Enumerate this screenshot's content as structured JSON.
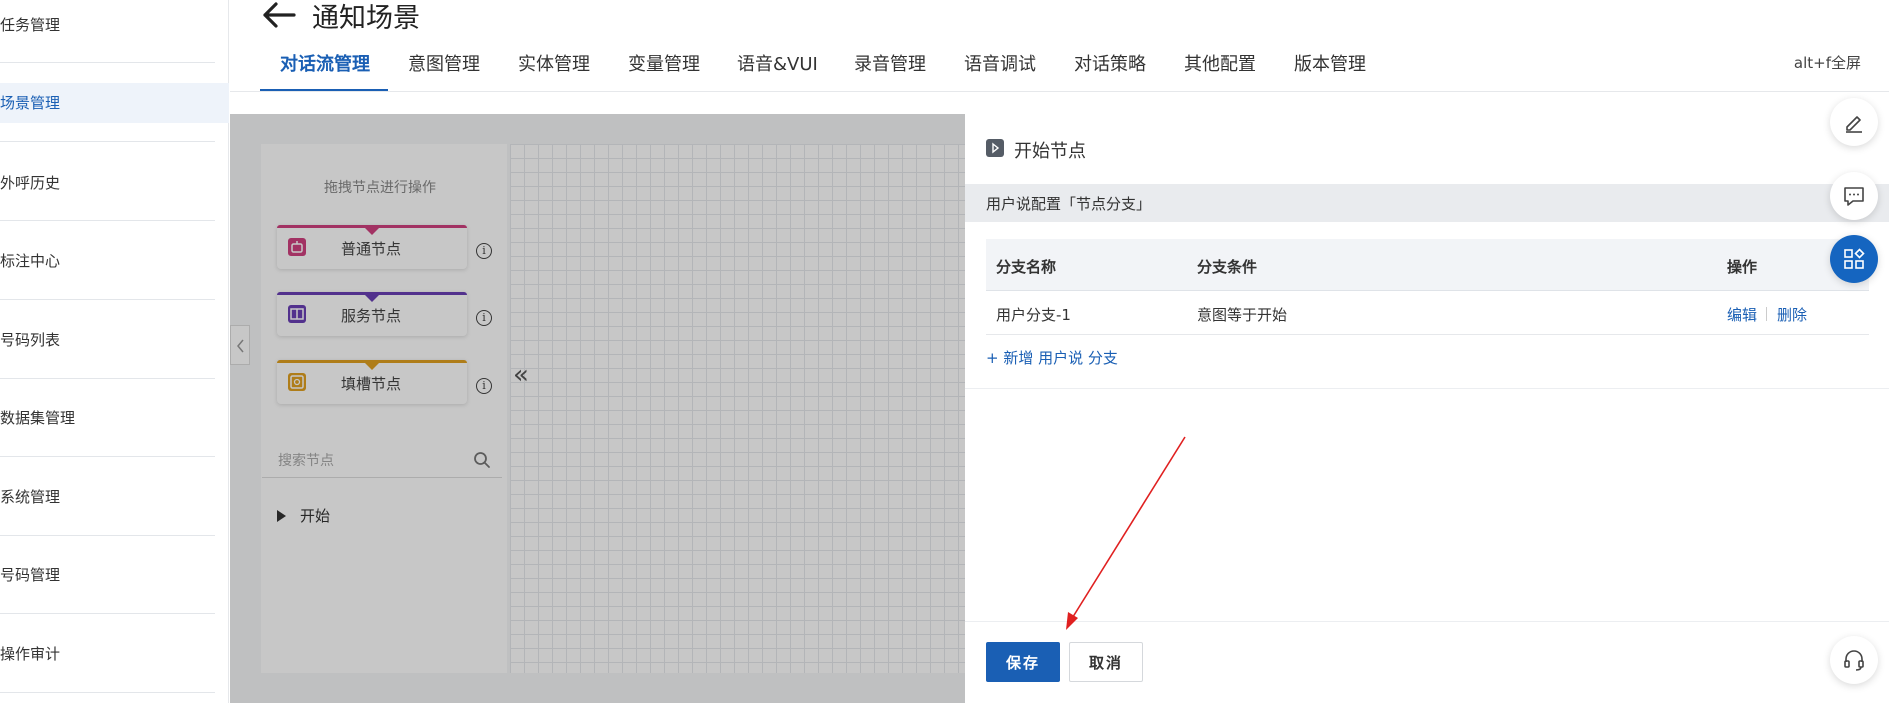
{
  "sidebar": {
    "items": [
      {
        "label": "任务管理"
      },
      {
        "label": "场景管理"
      },
      {
        "label": "外呼历史"
      },
      {
        "label": "标注中心"
      },
      {
        "label": "号码列表"
      },
      {
        "label": "数据集管理"
      },
      {
        "label": "系统管理"
      },
      {
        "label": "号码管理"
      },
      {
        "label": "操作审计"
      }
    ],
    "active_index": 1
  },
  "header": {
    "title": "通知场景",
    "tabs": [
      {
        "label": "对话流管理"
      },
      {
        "label": "意图管理"
      },
      {
        "label": "实体管理"
      },
      {
        "label": "变量管理"
      },
      {
        "label": "语音&VUI"
      },
      {
        "label": "录音管理"
      },
      {
        "label": "语音调试"
      },
      {
        "label": "对话策略"
      },
      {
        "label": "其他配置"
      },
      {
        "label": "版本管理"
      }
    ],
    "active_tab_index": 0,
    "fullscreen_hint": "alt+f全屏"
  },
  "canvas": {
    "drag_hint": "拖拽节点进行操作",
    "nodes": [
      {
        "label": "普通节点",
        "color": "#d0407f"
      },
      {
        "label": "服务节点",
        "color": "#6a3fb5"
      },
      {
        "label": "填槽节点",
        "color": "#e0a020"
      }
    ],
    "search": {
      "placeholder": "搜索节点",
      "value": ""
    },
    "tree_root": "开始",
    "collapse_glyph": "«"
  },
  "drawer": {
    "title": "开始节点",
    "section_title": "用户说配置「节点分支」",
    "table": {
      "headers": [
        "分支名称",
        "分支条件",
        "操作"
      ],
      "rows": [
        {
          "name": "用户分支-1",
          "condition": "意图等于开始",
          "actions": [
            "编辑",
            "删除"
          ]
        }
      ]
    },
    "add_branch_label": "+ 新增 用户说 分支",
    "save_label": "保存",
    "cancel_label": "取消"
  },
  "floating_tools": [
    "edit-icon",
    "chat-icon",
    "apps-icon",
    "headset-icon"
  ],
  "colors": {
    "accent": "#1a5fb4",
    "annotation_arrow": "#e02020"
  }
}
